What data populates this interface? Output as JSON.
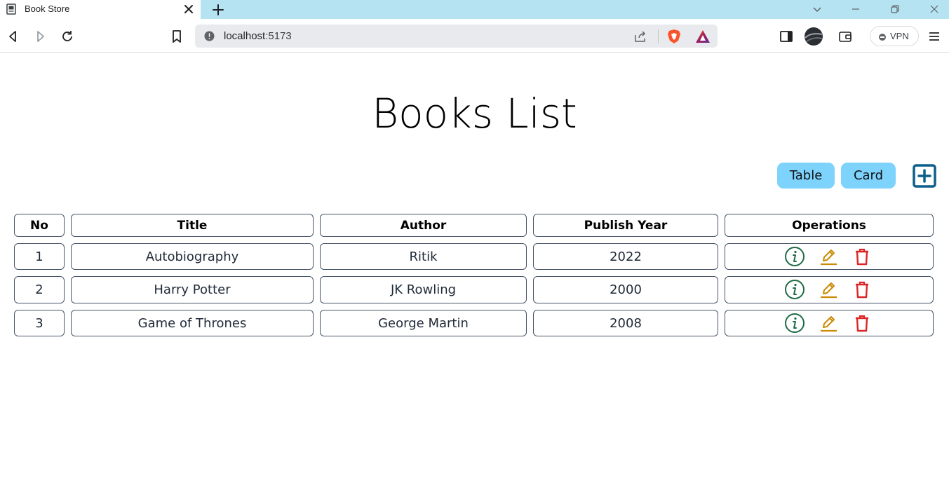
{
  "browser": {
    "tab_title": "Book Store",
    "url_host": "localhost",
    "url_port": ":5173",
    "vpn_label": "VPN"
  },
  "page": {
    "title": "Books List",
    "view_buttons": {
      "table": "Table",
      "card": "Card"
    }
  },
  "table": {
    "headers": [
      "No",
      "Title",
      "Author",
      "Publish Year",
      "Operations"
    ],
    "rows": [
      {
        "no": "1",
        "title": "Autobiography",
        "author": "Ritik",
        "year": "2022"
      },
      {
        "no": "2",
        "title": "Harry Potter",
        "author": "JK Rowling",
        "year": "2000"
      },
      {
        "no": "3",
        "title": "Game of Thrones",
        "author": "George Martin",
        "year": "2008"
      }
    ]
  },
  "colors": {
    "tabstrip": "#b5e3f2",
    "view_button": "#7dd3fc",
    "add_icon": "#0c5f8a",
    "info_icon": "#1e6b45",
    "edit_icon": "#ca8a04",
    "delete_icon": "#dc2626"
  }
}
